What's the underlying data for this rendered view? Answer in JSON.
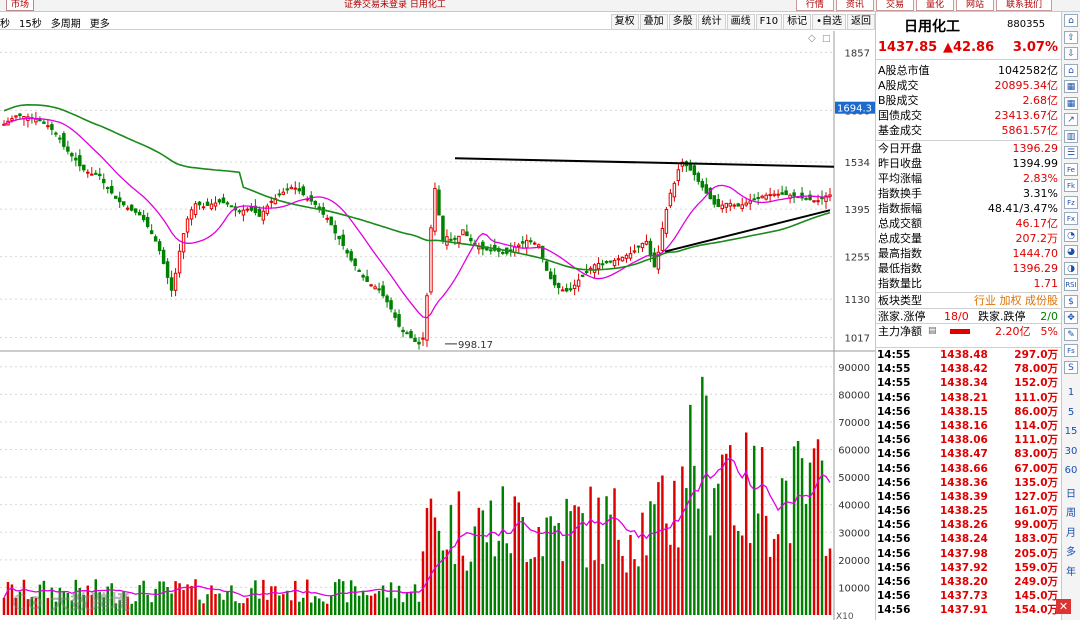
{
  "titlebar": {
    "tab": "市场",
    "center": "证券交易未登录  日用化工",
    "buttons": [
      "行情",
      "资讯",
      "交易",
      "量化",
      "网站",
      "联系我们"
    ]
  },
  "toolbar": {
    "left": [
      "秒",
      "15秒",
      "多周期",
      "更多"
    ],
    "right": [
      "复权",
      "叠加",
      "多股",
      "统计",
      "画线",
      "F10",
      "标记",
      "自选",
      "返回"
    ]
  },
  "chart_data": {
    "type": "candlestick",
    "price_axis": {
      "ticks": [
        1857,
        1686,
        1534,
        1395,
        1255,
        1130,
        1017
      ],
      "range": [
        980,
        1920
      ]
    },
    "volume_axis": {
      "ticks": [
        90000,
        80000,
        70000,
        60000,
        50000,
        40000,
        30000,
        20000,
        10000
      ],
      "range": [
        0,
        95000
      ],
      "unit": "X10"
    },
    "price_marker": "1694.3",
    "low_annotation": "998.17",
    "bars": 210,
    "close_series": [
      1645,
      1654,
      1662,
      1670,
      1671,
      1668,
      1667,
      1662,
      1660,
      1656,
      1648,
      1641,
      1630,
      1618,
      1604,
      1580,
      1566,
      1552,
      1540,
      1523,
      1511,
      1504,
      1498,
      1499,
      1494,
      1473,
      1457,
      1443,
      1427,
      1417,
      1408,
      1398,
      1392,
      1386,
      1378,
      1364,
      1344,
      1323,
      1301,
      1273,
      1235,
      1194,
      1156,
      1206,
      1271,
      1323,
      1366,
      1393,
      1411,
      1408,
      1402,
      1406,
      1410,
      1413,
      1416,
      1414,
      1410,
      1403,
      1393,
      1389,
      1392,
      1395,
      1392,
      1385,
      1374,
      1389,
      1404,
      1418,
      1426,
      1437,
      1445,
      1452,
      1459,
      1457,
      1449,
      1438,
      1425,
      1419,
      1409,
      1397,
      1380,
      1368,
      1349,
      1325,
      1308,
      1288,
      1266,
      1245,
      1229,
      1213,
      1195,
      1182,
      1172,
      1166,
      1157,
      1140,
      1122,
      1101,
      1076,
      1050,
      1034,
      1028,
      1016,
      1005,
      998,
      1015,
      1140,
      1340,
      1456,
      1378,
      1304,
      1314,
      1305,
      1308,
      1315,
      1334,
      1317,
      1302,
      1292,
      1284,
      1278,
      1275,
      1274,
      1274,
      1271,
      1267,
      1265,
      1272,
      1283,
      1289,
      1295,
      1303,
      1299,
      1295,
      1290,
      1253,
      1215,
      1190,
      1172,
      1164,
      1157,
      1154,
      1159,
      1171,
      1186,
      1197,
      1209,
      1221,
      1231,
      1235,
      1234,
      1237,
      1240,
      1244,
      1249,
      1253,
      1259,
      1264,
      1272,
      1284,
      1294,
      1300,
      1257,
      1225,
      1268,
      1338,
      1394,
      1442,
      1471,
      1511,
      1533,
      1523,
      1510,
      1497,
      1477,
      1460,
      1442,
      1426,
      1410,
      1403,
      1407,
      1412,
      1412,
      1407,
      1404,
      1408,
      1413,
      1419,
      1424,
      1428,
      1433,
      1436,
      1438,
      1439,
      1439,
      1439,
      1438,
      1436,
      1434,
      1431,
      1428,
      1425,
      1423,
      1420,
      1420,
      1426,
      1434,
      1437
    ]
  },
  "panel": {
    "name": "日用化工",
    "code": "880355",
    "price": "1437.85",
    "change": "▲42.86",
    "change_pct": "3.07%",
    "stats1": [
      {
        "k": "A股总市值",
        "v": "1042582亿",
        "c": ""
      },
      {
        "k": "A股成交",
        "v": "20895.34亿",
        "c": "red"
      },
      {
        "k": "B股成交",
        "v": "2.68亿",
        "c": "red"
      },
      {
        "k": "国债成交",
        "v": "23413.67亿",
        "c": "red"
      },
      {
        "k": "基金成交",
        "v": "5861.57亿",
        "c": "red"
      }
    ],
    "stats2": [
      {
        "k": "今日开盘",
        "v": "1396.29",
        "c": "red"
      },
      {
        "k": "昨日收盘",
        "v": "1394.99",
        "c": ""
      },
      {
        "k": "平均涨幅",
        "v": "2.83%",
        "c": "red"
      },
      {
        "k": "指数换手",
        "v": "3.31%",
        "c": ""
      },
      {
        "k": "指数振幅",
        "v": "48.41/3.47%",
        "c": ""
      },
      {
        "k": "总成交额",
        "v": "46.17亿",
        "c": "red"
      },
      {
        "k": "总成交量",
        "v": "207.2万",
        "c": "red"
      },
      {
        "k": "最高指数",
        "v": "1444.70",
        "c": "red"
      },
      {
        "k": "最低指数",
        "v": "1396.29",
        "c": "red"
      },
      {
        "k": "指数量比",
        "v": "1.71",
        "c": "red"
      }
    ],
    "board_type": {
      "k": "板块类型",
      "v": "行业 加权 成份股"
    },
    "updown": {
      "k": "涨家.涨停",
      "v1": "18/0",
      "k2": "跌家.跌停",
      "v2": "2/0"
    },
    "mainflow": {
      "k": "主力净额",
      "v": "2.20亿",
      "pct": "5%"
    },
    "trades": [
      {
        "t": "14:55",
        "p": "1438.48",
        "v": "297.0万"
      },
      {
        "t": "14:55",
        "p": "1438.42",
        "v": "78.00万"
      },
      {
        "t": "14:55",
        "p": "1438.34",
        "v": "152.0万"
      },
      {
        "t": "14:56",
        "p": "1438.21",
        "v": "111.0万"
      },
      {
        "t": "14:56",
        "p": "1438.15",
        "v": "86.00万"
      },
      {
        "t": "14:56",
        "p": "1438.16",
        "v": "114.0万"
      },
      {
        "t": "14:56",
        "p": "1438.06",
        "v": "111.0万"
      },
      {
        "t": "14:56",
        "p": "1438.47",
        "v": "83.00万"
      },
      {
        "t": "14:56",
        "p": "1438.66",
        "v": "67.00万"
      },
      {
        "t": "14:56",
        "p": "1438.36",
        "v": "135.0万"
      },
      {
        "t": "14:56",
        "p": "1438.39",
        "v": "127.0万"
      },
      {
        "t": "14:56",
        "p": "1438.25",
        "v": "161.0万"
      },
      {
        "t": "14:56",
        "p": "1438.26",
        "v": "99.00万"
      },
      {
        "t": "14:56",
        "p": "1438.24",
        "v": "183.0万"
      },
      {
        "t": "14:56",
        "p": "1437.98",
        "v": "205.0万"
      },
      {
        "t": "14:56",
        "p": "1437.92",
        "v": "159.0万"
      },
      {
        "t": "14:56",
        "p": "1438.20",
        "v": "249.0万"
      },
      {
        "t": "14:56",
        "p": "1437.73",
        "v": "145.0万"
      },
      {
        "t": "14:56",
        "p": "1437.91",
        "v": "154.0万"
      }
    ]
  },
  "sidebar": {
    "icons": [
      "pin-icon",
      "arrow-up-icon",
      "arrow-down-icon",
      "home-icon",
      "grid-icon",
      "grid-icon",
      "line-icon",
      "kline-icon",
      "list-icon",
      "fe-icon",
      "fk-icon",
      "fz-icon",
      "fx-icon",
      "gauge-icon",
      "gauge2-icon",
      "pie-icon",
      "rsi-icon",
      "flow-icon",
      "move-icon",
      "pen-icon",
      "fs-icon",
      "fs2-icon"
    ],
    "letters": [
      "1",
      "5",
      "15",
      "30",
      "60",
      "日",
      "周",
      "月",
      "多",
      "年"
    ]
  },
  "watermark": "大数跨境",
  "colors": {
    "up": "#e00000",
    "down": "#008000",
    "ma_pink": "#e000e0",
    "ma_green": "#1a8a1a",
    "trend": "#000000"
  }
}
